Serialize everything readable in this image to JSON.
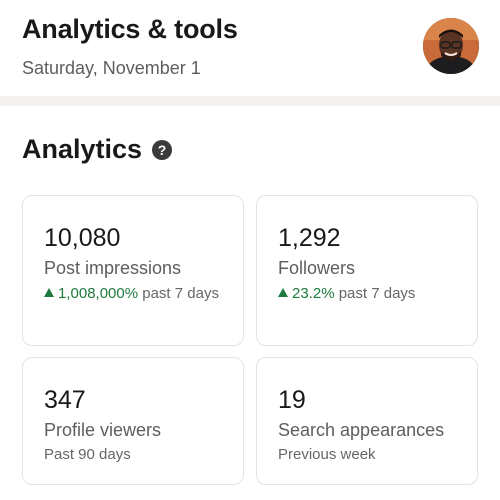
{
  "header": {
    "title": "Analytics & tools",
    "date": "Saturday, November 1"
  },
  "section": {
    "title": "Analytics",
    "help_glyph": "?"
  },
  "cards": [
    {
      "value": "10,080",
      "label": "Post impressions",
      "trend_pct": "1,008,000%",
      "trend_text": " past 7 days"
    },
    {
      "value": "1,292",
      "label": "Followers",
      "trend_pct": "23.2%",
      "trend_text": " past 7 days"
    },
    {
      "value": "347",
      "label": "Profile viewers",
      "sub": "Past 90 days"
    },
    {
      "value": "19",
      "label": "Search appearances",
      "sub": "Previous week"
    }
  ],
  "colors": {
    "positive_trend": "#1e7a3d",
    "divider": "#f4f2ee"
  }
}
